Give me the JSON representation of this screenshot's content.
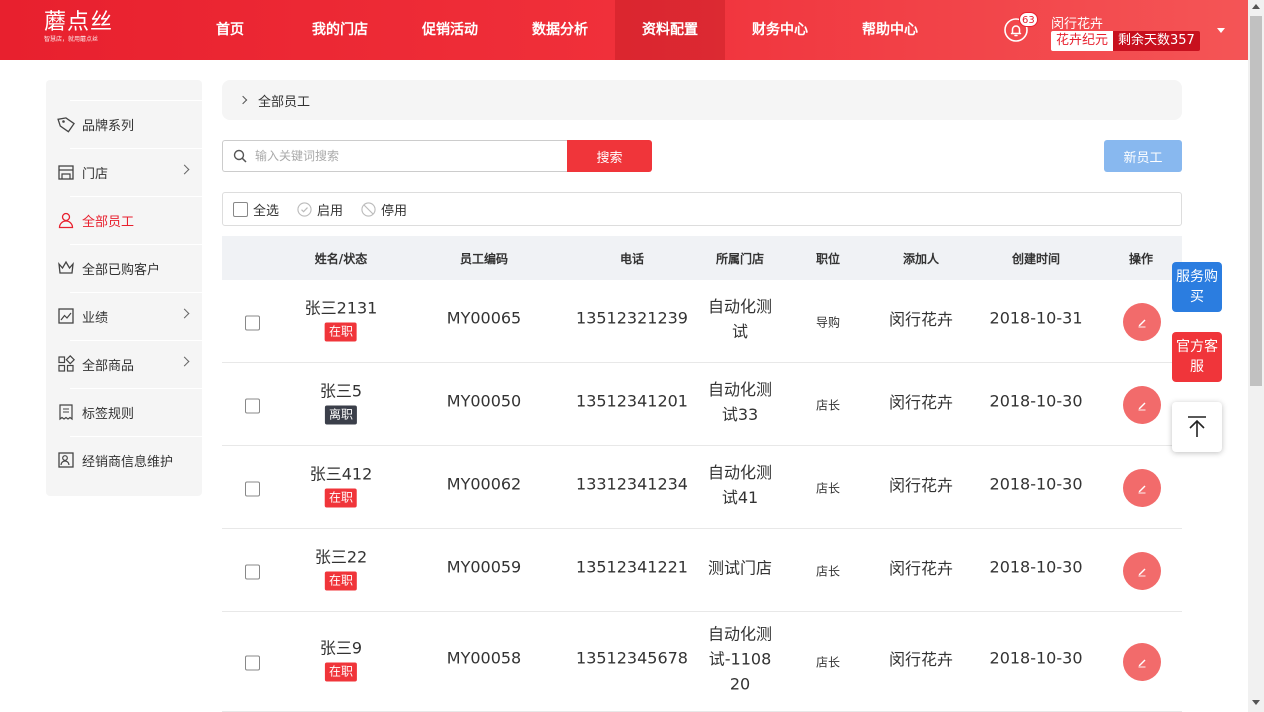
{
  "brand": {
    "logo_text": "蘑点丝",
    "logo_sub": "智慧店，就用蘑点丝"
  },
  "nav": [
    {
      "label": "首页"
    },
    {
      "label": "我的门店"
    },
    {
      "label": "促销活动"
    },
    {
      "label": "数据分析"
    },
    {
      "label": "资料配置",
      "active": true
    },
    {
      "label": "财务中心"
    },
    {
      "label": "帮助中心"
    }
  ],
  "user": {
    "notif_count": "63",
    "name": "闵行花卉",
    "store": "花卉纪元",
    "days_left": "剩余天数357"
  },
  "sidebar": [
    {
      "label": "品牌系列",
      "icon": "tag-icon",
      "arrow": false
    },
    {
      "label": "门店",
      "icon": "store-icon",
      "arrow": true
    },
    {
      "label": "全部员工",
      "icon": "user-icon",
      "arrow": false,
      "active": true
    },
    {
      "label": "全部已购客户",
      "icon": "crown-icon",
      "arrow": false
    },
    {
      "label": "业绩",
      "icon": "chart-icon",
      "arrow": true
    },
    {
      "label": "全部商品",
      "icon": "grid-icon",
      "arrow": true
    },
    {
      "label": "标签规则",
      "icon": "receipt-icon",
      "arrow": false
    },
    {
      "label": "经销商信息维护",
      "icon": "profile-icon",
      "arrow": false
    }
  ],
  "breadcrumb": "全部员工",
  "search": {
    "placeholder": "输入关键词搜索",
    "button": "搜索"
  },
  "new_button": "新员工",
  "filters": {
    "select_all": "全选",
    "enabled": "启用",
    "disabled": "停用"
  },
  "table": {
    "headers": [
      "姓名/状态",
      "员工编码",
      "电话",
      "所属门店",
      "职位",
      "添加人",
      "创建时间",
      "操作"
    ],
    "rows": [
      {
        "name": "张三2131",
        "status": "在职",
        "active": true,
        "code": "MY00065",
        "phone": "13512321239",
        "store": "自动化测试",
        "position": "导购",
        "creator": "闵行花卉",
        "created": "2018-10-31"
      },
      {
        "name": "张三5",
        "status": "离职",
        "active": false,
        "code": "MY00050",
        "phone": "13512341201",
        "store": "自动化测试33",
        "position": "店长",
        "creator": "闵行花卉",
        "created": "2018-10-30"
      },
      {
        "name": "张三412",
        "status": "在职",
        "active": true,
        "code": "MY00062",
        "phone": "13312341234",
        "store": "自动化测试41",
        "position": "店长",
        "creator": "闵行花卉",
        "created": "2018-10-30"
      },
      {
        "name": "张三22",
        "status": "在职",
        "active": true,
        "code": "MY00059",
        "phone": "13512341221",
        "store": "测试门店",
        "position": "店长",
        "creator": "闵行花卉",
        "created": "2018-10-30"
      },
      {
        "name": "张三9",
        "status": "在职",
        "active": true,
        "code": "MY00058",
        "phone": "13512345678",
        "store": "自动化测试-110820",
        "position": "店长",
        "creator": "闵行花卉",
        "created": "2018-10-30"
      }
    ]
  },
  "floating": {
    "service": "服务购买",
    "support": "官方客服"
  }
}
